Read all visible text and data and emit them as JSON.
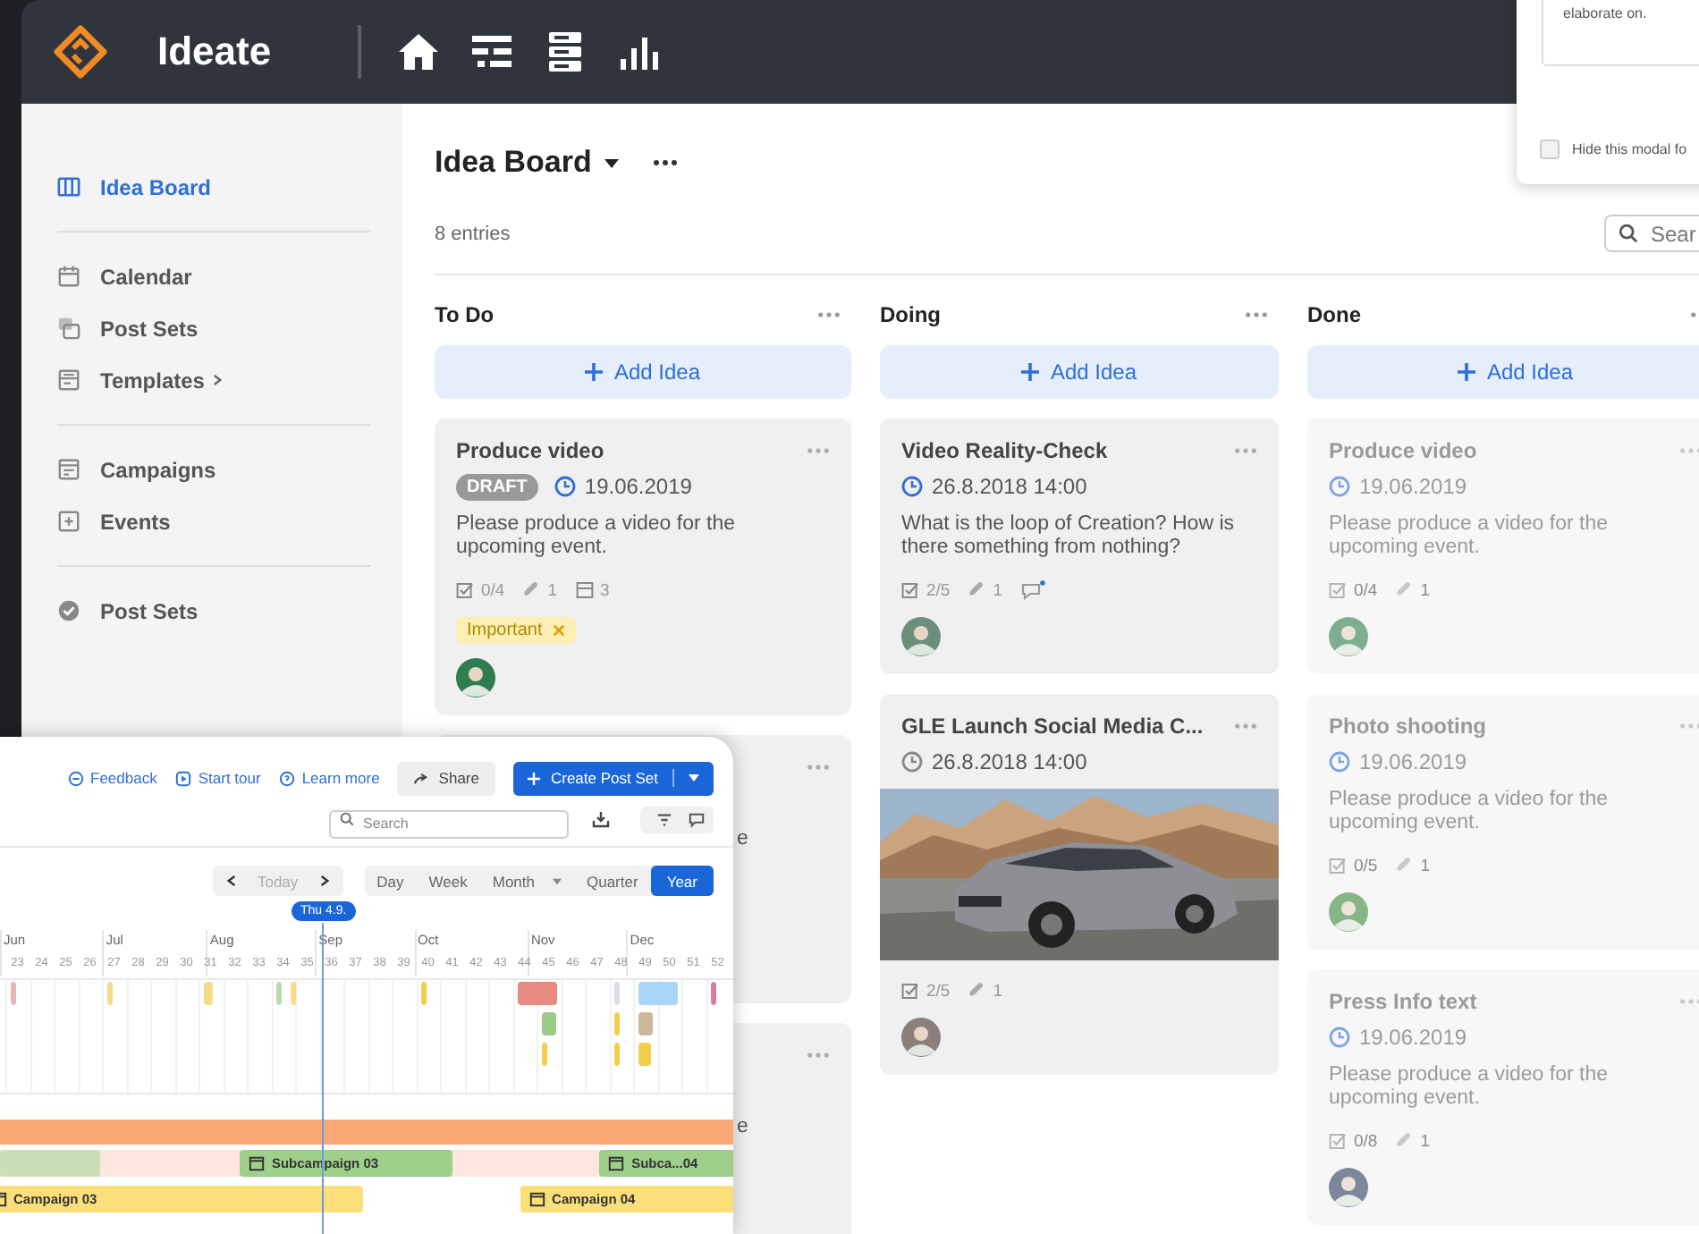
{
  "topbar": {
    "app_name": "Ideate"
  },
  "modal": {
    "text": "elaborate on.",
    "checkbox": {
      "label": "Hide this modal fo",
      "checked": false
    }
  },
  "sidebar": {
    "groups": [
      [
        {
          "label": "Idea Board",
          "selected": true,
          "submenu": false
        }
      ],
      [
        {
          "label": "Calendar",
          "selected": false,
          "submenu": false
        },
        {
          "label": "Post Sets",
          "selected": false,
          "submenu": false
        },
        {
          "label": "Templates",
          "selected": false,
          "submenu": true
        }
      ],
      [
        {
          "label": "Campaigns",
          "selected": false,
          "submenu": false
        },
        {
          "label": "Events",
          "selected": false,
          "submenu": false
        }
      ],
      [
        {
          "label": "Post Sets",
          "selected": false,
          "submenu": false
        }
      ]
    ]
  },
  "board": {
    "title": "Idea Board",
    "count": "8 entries",
    "search_placeholder": "Sear",
    "columns": [
      {
        "title": "To Do",
        "add_label": "Add Idea",
        "dimmed": false,
        "cards": [
          {
            "kind": "full",
            "title": "Produce video",
            "badge": "DRAFT",
            "date": "19.06.2019",
            "date_active": true,
            "description": "Please produce a video for the upcoming event.",
            "stats": [
              {
                "kind": "tasks",
                "text": "0/4"
              },
              {
                "kind": "attachments",
                "text": "1"
              },
              {
                "kind": "posts",
                "text": "3"
              }
            ],
            "tags": [
              {
                "label": "Important"
              }
            ],
            "avatar": true
          },
          {
            "kind": "covered",
            "fragment": "e"
          },
          {
            "kind": "covered",
            "fragment": "e"
          }
        ]
      },
      {
        "title": "Doing",
        "add_label": "Add Idea",
        "dimmed": false,
        "cards": [
          {
            "kind": "full",
            "title": "Video Reality-Check",
            "date": "26.8.2018 14:00",
            "date_active": true,
            "description": "What is the loop of Creation? How is there something from nothing?",
            "stats": [
              {
                "kind": "tasks",
                "text": "2/5"
              },
              {
                "kind": "attachments",
                "text": "1"
              },
              {
                "kind": "comments"
              }
            ],
            "avatar": true
          },
          {
            "kind": "full",
            "title": "GLE Launch Social Media C...",
            "date": "26.8.2018 14:00",
            "date_active": false,
            "image": {
              "kind": "picture"
            },
            "stats": [
              {
                "kind": "tasks",
                "text": "2/5"
              },
              {
                "kind": "attachments",
                "text": "1"
              }
            ],
            "avatar": true
          }
        ]
      },
      {
        "title": "Done",
        "add_label": "Add Idea",
        "dimmed": true,
        "cards": [
          {
            "kind": "full",
            "title": "Produce video",
            "date": "19.06.2019",
            "date_active": true,
            "description": "Please produce a video for the upcoming event.",
            "stats": [
              {
                "kind": "tasks",
                "text": "0/4"
              },
              {
                "kind": "attachments",
                "text": "1"
              }
            ],
            "avatar": true
          },
          {
            "kind": "full",
            "title": "Photo shooting",
            "date": "19.06.2019",
            "date_active": true,
            "description": "Please produce a video for the upcoming event.",
            "stats": [
              {
                "kind": "tasks",
                "text": "0/5"
              },
              {
                "kind": "attachments",
                "text": "1"
              }
            ],
            "avatar": true
          },
          {
            "kind": "full",
            "title": "Press Info text",
            "date": "19.06.2019",
            "date_active": true,
            "description": "Please produce a video for the upcoming event.",
            "stats": [
              {
                "kind": "tasks",
                "text": "0/8"
              },
              {
                "kind": "attachments",
                "text": "1"
              }
            ],
            "avatar": true
          }
        ]
      }
    ]
  },
  "timeline": {
    "links": [
      {
        "label": "Feedback"
      },
      {
        "label": "Start tour"
      },
      {
        "label": "Learn more"
      }
    ],
    "share": "Share",
    "create": "Create Post Set",
    "search_placeholder": "Search",
    "today": "Today",
    "views": [
      {
        "label": "Day",
        "selected": false
      },
      {
        "label": "Week",
        "selected": false
      },
      {
        "label": "Month",
        "selected": false
      },
      {
        "label": "Quarter",
        "selected": false
      },
      {
        "label": "Year",
        "selected": true
      }
    ],
    "marker": "Thu 4.9.",
    "months": [
      "Jun",
      "Jul",
      "Aug",
      "Sep",
      "Oct",
      "Nov",
      "Dec"
    ],
    "weeks": [
      "23",
      "24",
      "25",
      "26",
      "27",
      "28",
      "29",
      "30",
      "31",
      "32",
      "33",
      "34",
      "35",
      "36",
      "37",
      "38",
      "39",
      "40",
      "41",
      "42",
      "43",
      "44",
      "45",
      "46",
      "47",
      "48",
      "49",
      "50",
      "51",
      "52"
    ],
    "bars": [
      {
        "label": "Subcampaign 03",
        "color": "#9fd08a"
      },
      {
        "label": "Subca...04",
        "color": "#9fd08a"
      },
      {
        "label": "Campaign 03",
        "color": "#fbe07a"
      },
      {
        "label": "Campaign 04",
        "color": "#fbe07a"
      }
    ]
  }
}
